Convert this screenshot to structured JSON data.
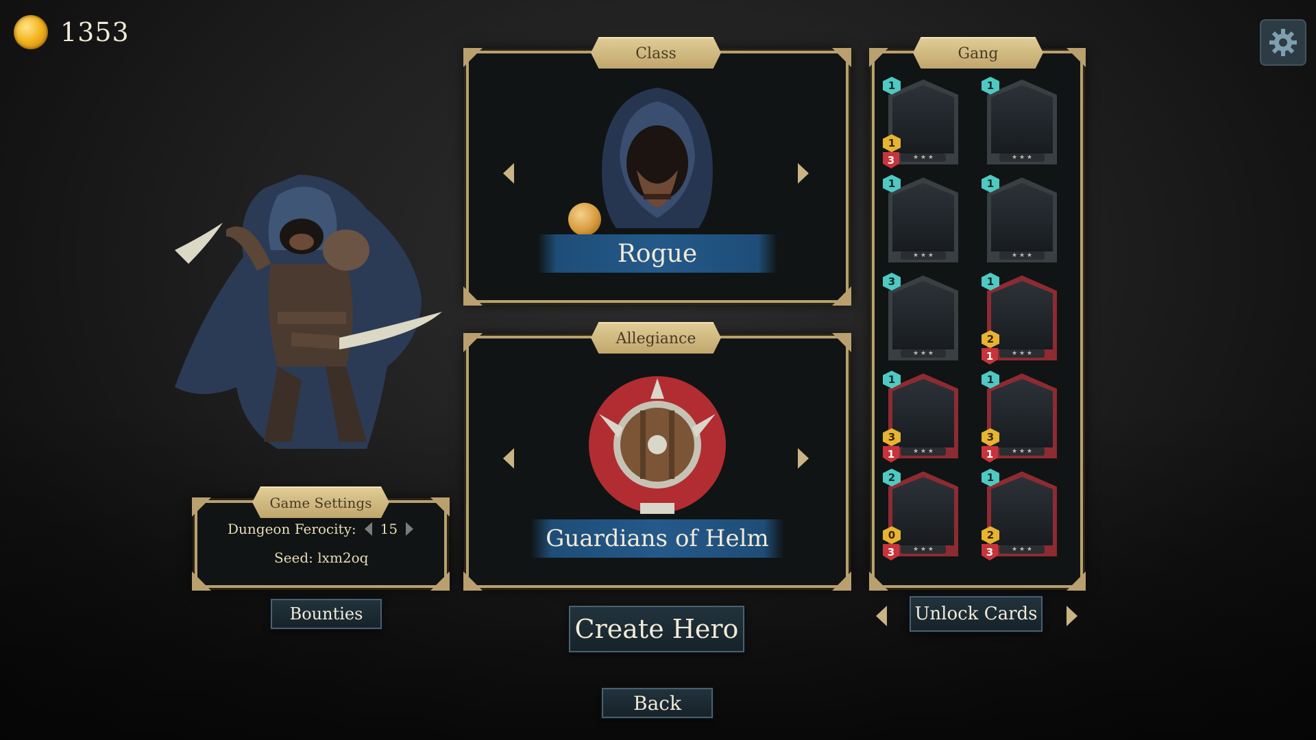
{
  "currency": {
    "icon": "coin-icon",
    "amount": "1353",
    "color": "#f4b621"
  },
  "settings": {
    "icon": "gear-icon"
  },
  "hero": {
    "portrait": "hooded-rogue-illustration"
  },
  "class_panel": {
    "title": "Class",
    "name": "Rogue",
    "portrait": "hooded-rogue-face",
    "prev_icon": "arrow-left-icon",
    "next_icon": "arrow-right-icon"
  },
  "allegiance_panel": {
    "title": "Allegiance",
    "name": "Guardians of Helm",
    "emblem": "shield-emblem",
    "prev_icon": "arrow-left-icon",
    "next_icon": "arrow-right-icon"
  },
  "gang_panel": {
    "title": "Gang",
    "cards": [
      {
        "cost": "1",
        "attack": "1",
        "health": "3",
        "art": "soldier-portrait",
        "color": "#3a3f44"
      },
      {
        "cost": "1",
        "art": "axe-slash",
        "color": "#3a3f44"
      },
      {
        "cost": "1",
        "art": "eye-sigil",
        "color": "#3a3f44"
      },
      {
        "cost": "1",
        "art": "crossed-daggers",
        "color": "#3a3f44"
      },
      {
        "cost": "3",
        "art": "red-slash",
        "color": "#3a3f44"
      },
      {
        "cost": "1",
        "attack": "2",
        "health": "1",
        "art": "woman-portrait",
        "color": "#8e2b32"
      },
      {
        "cost": "1",
        "attack": "3",
        "health": "1",
        "art": "rogue-portrait",
        "color": "#8e2b32"
      },
      {
        "cost": "1",
        "attack": "3",
        "health": "1",
        "art": "rogue-portrait",
        "color": "#8e2b32"
      },
      {
        "cost": "2",
        "attack": "0",
        "health": "3",
        "art": "banner-ship",
        "color": "#8e2b32"
      },
      {
        "cost": "1",
        "attack": "2",
        "health": "3",
        "art": "armored-knight",
        "color": "#8e2b32"
      }
    ]
  },
  "game_settings": {
    "title": "Game Settings",
    "ferocity_label": "Dungeon Ferocity:",
    "ferocity_value": "15",
    "seed_label": "Seed: lxm2oq"
  },
  "buttons": {
    "bounties": "Bounties",
    "create_hero": "Create Hero",
    "unlock_cards": "Unlock Cards",
    "back": "Back"
  }
}
